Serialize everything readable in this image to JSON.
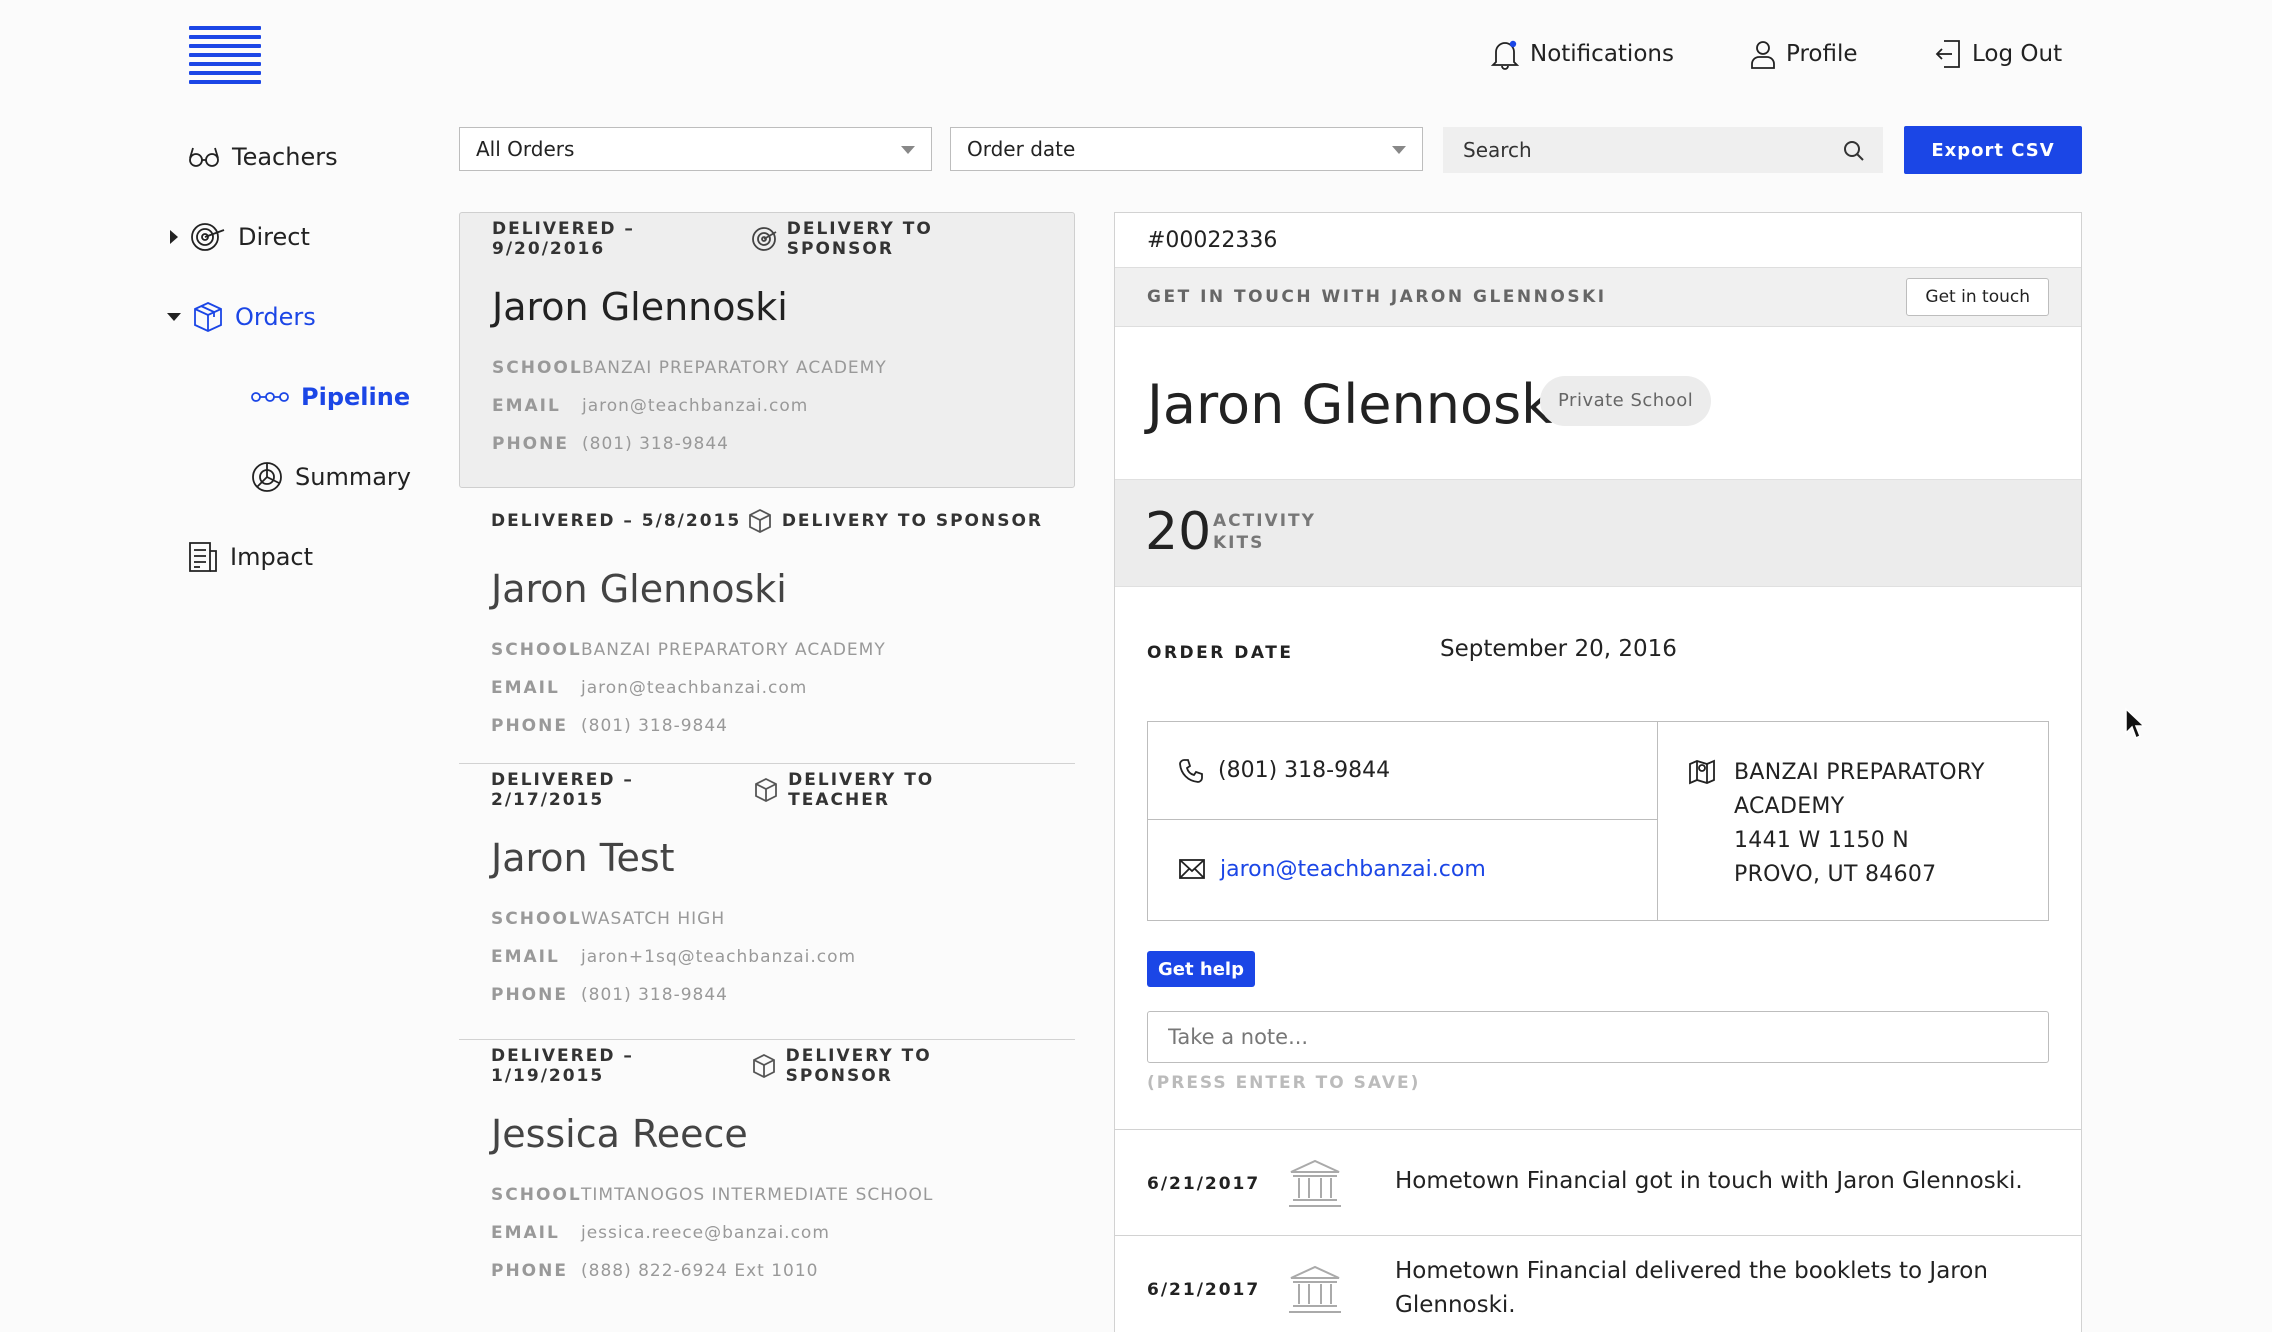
{
  "header": {
    "nav": [
      {
        "label": "Notifications",
        "icon": "bell-icon"
      },
      {
        "label": "Profile",
        "icon": "user-icon"
      },
      {
        "label": "Log Out",
        "icon": "logout-icon"
      }
    ]
  },
  "sidebar": {
    "items": [
      {
        "label": "Teachers",
        "icon": "glasses-icon"
      },
      {
        "label": "Direct",
        "icon": "target-icon"
      },
      {
        "label": "Orders",
        "icon": "box-icon"
      },
      {
        "label": "Pipeline",
        "icon": "pipeline-icon"
      },
      {
        "label": "Summary",
        "icon": "summary-icon"
      },
      {
        "label": "Impact",
        "icon": "report-icon"
      }
    ]
  },
  "toolbar": {
    "filter": "All Orders",
    "sort": "Order date",
    "search_placeholder": "Search",
    "export_label": "Export CSV"
  },
  "labels": {
    "school": "SCHOOL",
    "email": "EMAIL",
    "phone": "PHONE"
  },
  "orders": [
    {
      "status": "DELIVERED – 9/20/2016",
      "delivery": "DELIVERY TO SPONSOR",
      "name": "Jaron Glennoski",
      "school": "BANZAI PREPARATORY ACADEMY",
      "email": "jaron@teachbanzai.com",
      "phone": "(801) 318-9844"
    },
    {
      "status": "DELIVERED – 5/8/2015",
      "delivery": "DELIVERY TO SPONSOR",
      "name": "Jaron Glennoski",
      "school": "BANZAI PREPARATORY ACADEMY",
      "email": "jaron@teachbanzai.com",
      "phone": "(801) 318-9844"
    },
    {
      "status": "DELIVERED – 2/17/2015",
      "delivery": "DELIVERY TO TEACHER",
      "name": "Jaron Test",
      "school": "WASATCH HIGH",
      "email": "jaron+1sq@teachbanzai.com",
      "phone": "(801) 318-9844"
    },
    {
      "status": "DELIVERED – 1/19/2015",
      "delivery": "DELIVERY TO SPONSOR",
      "name": "Jessica Reece",
      "school": "TIMTANOGOS INTERMEDIATE SCHOOL",
      "email": "jessica.reece@banzai.com",
      "phone": "(888) 822-6924 Ext 1010"
    }
  ],
  "detail": {
    "order_id": "#00022336",
    "touch_label": "GET IN TOUCH WITH JARON GLENNOSKI",
    "touch_button": "Get in touch",
    "name": "Jaron Glennoski",
    "school_type": "Private School",
    "kits_count": "20",
    "kits_label_1": "ACTIVITY",
    "kits_label_2": "KITS",
    "order_date_label": "ORDER DATE",
    "order_date": "September 20, 2016",
    "phone": "(801) 318-9844",
    "email": "jaron@teachbanzai.com",
    "address": [
      "BANZAI PREPARATORY",
      "ACADEMY",
      "1441 W 1150 N",
      "PROVO, UT 84607"
    ],
    "help_button": "Get help",
    "note_placeholder": "Take a note...",
    "note_hint": "(PRESS ENTER TO SAVE)",
    "activity": [
      {
        "date": "6/21/2017",
        "text": "Hometown Financial got in touch with Jaron Glennoski."
      },
      {
        "date": "6/21/2017",
        "text": "Hometown Financial delivered the booklets to Jaron Glennoski."
      }
    ]
  },
  "colors": {
    "accent": "#1b46e6",
    "text": "#222222",
    "muted": "#999999",
    "panel_gray": "#ececec"
  }
}
